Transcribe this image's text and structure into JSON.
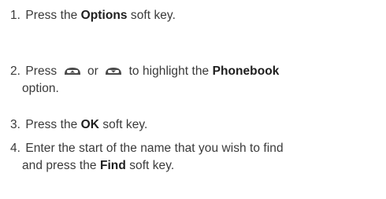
{
  "steps": [
    {
      "number": "1.",
      "text_before": "Press the",
      "keyword": "Options",
      "text_after": "soft key."
    },
    {
      "number": "2.",
      "text_before": "Press",
      "connector": "or",
      "text_middle": "to highlight the",
      "keyword": "Phonebook",
      "text_after": "option.",
      "icons": [
        "nav-key-up-icon",
        "nav-key-down-icon"
      ]
    },
    {
      "number": "3.",
      "text_before": "Press the",
      "keyword": "OK",
      "text_after": "soft key."
    },
    {
      "number": "4.",
      "text_before": "Enter the start of the name that you wish to find",
      "text_cont": "and press the",
      "keyword": "Find",
      "text_after": "soft key."
    }
  ]
}
